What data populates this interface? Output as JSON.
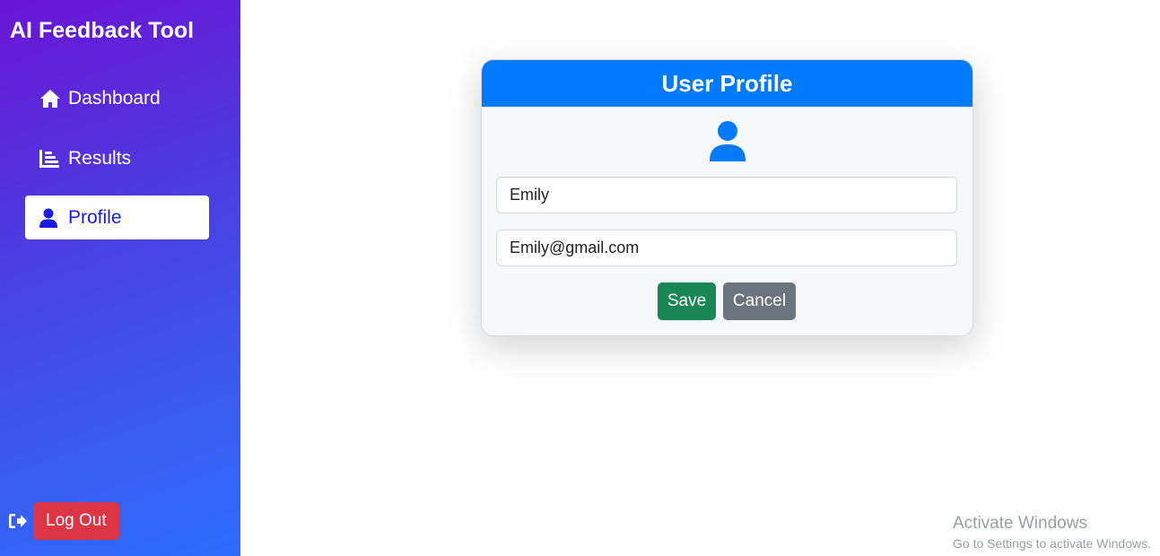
{
  "sidebar": {
    "brand": "AI Feedback Tool",
    "items": [
      {
        "label": "Dashboard",
        "icon": "home-icon"
      },
      {
        "label": "Results",
        "icon": "bar-chart-icon"
      },
      {
        "label": "Profile",
        "icon": "user-icon",
        "active": true
      }
    ],
    "logout_label": "Log Out",
    "logout_icon": "sign-out-icon"
  },
  "profile_card": {
    "title": "User Profile",
    "avatar_icon": "user-icon",
    "name_value": "Emily",
    "email_value": "Emily@gmail.com",
    "save_label": "Save",
    "cancel_label": "Cancel"
  },
  "watermark": {
    "title": "Activate Windows",
    "subtitle": "Go to Settings to activate Windows."
  },
  "colors": {
    "primary": "#007bff",
    "save": "#198754",
    "cancel": "#6c757d",
    "logout": "#dc3545",
    "active_text": "#1a1ae6"
  }
}
